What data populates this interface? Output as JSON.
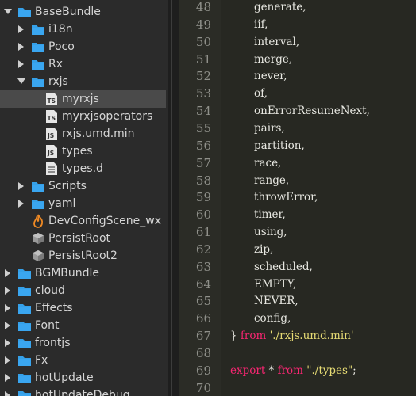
{
  "tree": {
    "items": [
      {
        "label": "BaseBundle",
        "arrow": "down",
        "icon": "folder-icon"
      },
      {
        "label": "i18n",
        "arrow": "right",
        "icon": "folder-icon"
      },
      {
        "label": "Poco",
        "arrow": "right",
        "icon": "folder-icon"
      },
      {
        "label": "Rx",
        "arrow": "right",
        "icon": "folder-icon"
      },
      {
        "label": "rxjs",
        "arrow": "down",
        "icon": "folder-icon"
      },
      {
        "label": "myrxjs",
        "arrow": "",
        "icon": "typescript-file-icon",
        "selected": true
      },
      {
        "label": "myrxjsoperators",
        "arrow": "",
        "icon": "typescript-file-icon"
      },
      {
        "label": "rxjs.umd.min",
        "arrow": "",
        "icon": "javascript-file-icon"
      },
      {
        "label": "types",
        "arrow": "",
        "icon": "javascript-file-icon"
      },
      {
        "label": "types.d",
        "arrow": "",
        "icon": "text-file-icon"
      },
      {
        "label": "Scripts",
        "arrow": "right",
        "icon": "folder-icon"
      },
      {
        "label": "yaml",
        "arrow": "right",
        "icon": "folder-icon"
      },
      {
        "label": "DevConfigScene_wx",
        "arrow": "",
        "icon": "scene-fire-icon"
      },
      {
        "label": "PersistRoot",
        "arrow": "",
        "icon": "prefab-icon"
      },
      {
        "label": "PersistRoot2",
        "arrow": "",
        "icon": "prefab-icon"
      },
      {
        "label": "BGMBundle",
        "arrow": "right",
        "icon": "folder-icon"
      },
      {
        "label": "cloud",
        "arrow": "right",
        "icon": "folder-icon"
      },
      {
        "label": "Effects",
        "arrow": "right",
        "icon": "folder-icon"
      },
      {
        "label": "Font",
        "arrow": "right",
        "icon": "folder-icon"
      },
      {
        "label": "frontjs",
        "arrow": "right",
        "icon": "folder-icon"
      },
      {
        "label": "Fx",
        "arrow": "right",
        "icon": "folder-icon"
      },
      {
        "label": "hotUpdate",
        "arrow": "right",
        "icon": "folder-icon"
      },
      {
        "label": "hotUpdateDebug",
        "arrow": "right",
        "icon": "folder-icon"
      }
    ]
  },
  "editor": {
    "lines": [
      {
        "num": "48",
        "indent": 1,
        "parts": [
          {
            "t": "generate,"
          }
        ]
      },
      {
        "num": "49",
        "indent": 1,
        "parts": [
          {
            "t": "iif,"
          }
        ]
      },
      {
        "num": "50",
        "indent": 1,
        "parts": [
          {
            "t": "interval,"
          }
        ]
      },
      {
        "num": "51",
        "indent": 1,
        "parts": [
          {
            "t": "merge,"
          }
        ]
      },
      {
        "num": "52",
        "indent": 1,
        "parts": [
          {
            "t": "never,"
          }
        ]
      },
      {
        "num": "53",
        "indent": 1,
        "parts": [
          {
            "t": "of,"
          }
        ]
      },
      {
        "num": "54",
        "indent": 1,
        "parts": [
          {
            "t": "onErrorResumeNext,"
          }
        ]
      },
      {
        "num": "55",
        "indent": 1,
        "parts": [
          {
            "t": "pairs,"
          }
        ]
      },
      {
        "num": "56",
        "indent": 1,
        "parts": [
          {
            "t": "partition,"
          }
        ]
      },
      {
        "num": "57",
        "indent": 1,
        "parts": [
          {
            "t": "race,"
          }
        ]
      },
      {
        "num": "58",
        "indent": 1,
        "parts": [
          {
            "t": "range,"
          }
        ]
      },
      {
        "num": "59",
        "indent": 1,
        "parts": [
          {
            "t": "throwError,"
          }
        ]
      },
      {
        "num": "60",
        "indent": 1,
        "parts": [
          {
            "t": "timer,"
          }
        ]
      },
      {
        "num": "61",
        "indent": 1,
        "parts": [
          {
            "t": "using,"
          }
        ]
      },
      {
        "num": "62",
        "indent": 1,
        "parts": [
          {
            "t": "zip,"
          }
        ]
      },
      {
        "num": "63",
        "indent": 1,
        "parts": [
          {
            "t": "scheduled,"
          }
        ]
      },
      {
        "num": "64",
        "indent": 1,
        "parts": [
          {
            "t": "EMPTY,"
          }
        ]
      },
      {
        "num": "65",
        "indent": 1,
        "parts": [
          {
            "t": "NEVER,"
          }
        ]
      },
      {
        "num": "66",
        "indent": 1,
        "parts": [
          {
            "t": "config,"
          }
        ]
      },
      {
        "num": "67",
        "indent": 0,
        "parts": [
          {
            "t": "} "
          },
          {
            "t": "from",
            "c": "kw"
          },
          {
            "t": " "
          },
          {
            "t": "'./rxjs.umd.min'",
            "c": "str"
          }
        ]
      },
      {
        "num": "68",
        "indent": 0,
        "parts": []
      },
      {
        "num": "69",
        "indent": 0,
        "parts": [
          {
            "t": "export",
            "c": "kw"
          },
          {
            "t": " * "
          },
          {
            "t": "from",
            "c": "kw"
          },
          {
            "t": " "
          },
          {
            "t": "\"./types\"",
            "c": "str"
          },
          {
            "t": ";"
          }
        ]
      },
      {
        "num": "70",
        "indent": 0,
        "parts": []
      }
    ]
  },
  "colors": {
    "folder": "#35a0e8",
    "selection": "#4a4a4a",
    "keyword": "#f92672",
    "string": "#e6db74",
    "editor_bg": "#272822"
  }
}
